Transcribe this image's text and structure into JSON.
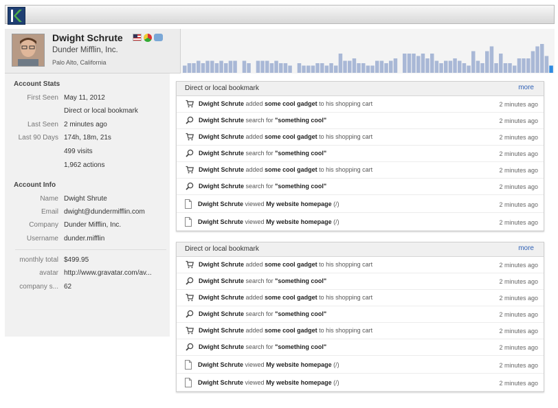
{
  "profile": {
    "name": "Dwight Schrute",
    "company": "Dunder Mifflin, Inc.",
    "location": "Palo Alto, California"
  },
  "activity_chart": {
    "type": "bar",
    "highlight_color": "#2f8be0",
    "bar_color": "#a9b8d6",
    "values": [
      3,
      4,
      4,
      5,
      4,
      5,
      5,
      4,
      5,
      4,
      5,
      5,
      0,
      5,
      4,
      0,
      5,
      5,
      5,
      4,
      5,
      4,
      4,
      3,
      0,
      4,
      3,
      3,
      3,
      4,
      4,
      3,
      4,
      3,
      8,
      5,
      5,
      6,
      4,
      4,
      3,
      3,
      5,
      5,
      4,
      5,
      6,
      0,
      8,
      8,
      8,
      7,
      8,
      6,
      8,
      5,
      4,
      5,
      5,
      6,
      5,
      4,
      3,
      9,
      5,
      4,
      9,
      11,
      4,
      8,
      4,
      4,
      3,
      6,
      6,
      6,
      9,
      11,
      12,
      7,
      3
    ],
    "highlight_last": true
  },
  "account_stats": {
    "title": "Account Stats",
    "rows": [
      {
        "key": "First Seen",
        "value": "May 11, 2012"
      },
      {
        "key": "",
        "value": "Direct or local bookmark"
      },
      {
        "key": "Last Seen",
        "value": "2 minutes ago"
      },
      {
        "key": "Last 90 Days",
        "value": "174h, 18m, 21s"
      },
      {
        "key": "",
        "value": "499 visits"
      },
      {
        "key": "",
        "value": "1,962 actions"
      }
    ]
  },
  "account_info": {
    "title": "Account Info",
    "rows": [
      {
        "key": "Name",
        "value": "Dwight Shrute"
      },
      {
        "key": "Email",
        "value": "dwight@dundermifflin.com"
      },
      {
        "key": "Company",
        "value": "Dunder Mifflin, Inc."
      },
      {
        "key": "Username",
        "value": "dunder.mifflin"
      }
    ],
    "extra": [
      {
        "key": "monthly total",
        "value": "$499.95"
      },
      {
        "key": "avatar",
        "value": "http://www.gravatar.com/av..."
      },
      {
        "key": "company s...",
        "value": "62"
      }
    ]
  },
  "panels": [
    {
      "title": "Direct or local bookmark",
      "more": "more",
      "items": [
        {
          "icon": "cart-icon",
          "user": "Dwight Schrute",
          "verb": "added",
          "object": "some cool gadget",
          "suffix": "to his shopping cart",
          "time": "2 minutes ago"
        },
        {
          "icon": "search-icon",
          "user": "Dwight Schrute",
          "verb": "search for",
          "object": "\"something cool\"",
          "suffix": "",
          "time": "2 minutes ago"
        },
        {
          "icon": "cart-icon",
          "user": "Dwight Schrute",
          "verb": "added",
          "object": "some cool gadget",
          "suffix": "to his shopping cart",
          "time": "2 minutes ago"
        },
        {
          "icon": "search-icon",
          "user": "Dwight Schrute",
          "verb": "search for",
          "object": "\"something cool\"",
          "suffix": "",
          "time": "2 minutes ago"
        },
        {
          "icon": "cart-icon",
          "user": "Dwight Schrute",
          "verb": "added",
          "object": "some cool gadget",
          "suffix": "to his shopping cart",
          "time": "2 minutes ago"
        },
        {
          "icon": "search-icon",
          "user": "Dwight Schrute",
          "verb": "search for",
          "object": "\"something cool\"",
          "suffix": "",
          "time": "2 minutes ago"
        },
        {
          "icon": "document-icon",
          "user": "Dwight Schrute",
          "verb": "viewed",
          "object": "My website homepage",
          "suffix": "(/)",
          "time": "2 minutes ago"
        },
        {
          "icon": "document-icon",
          "user": "Dwight Schrute",
          "verb": "viewed",
          "object": "My website homepage",
          "suffix": "(/)",
          "time": "2 minutes ago"
        }
      ]
    },
    {
      "title": "Direct or local bookmark",
      "more": "more",
      "items": [
        {
          "icon": "cart-icon",
          "user": "Dwight Schrute",
          "verb": "added",
          "object": "some cool gadget",
          "suffix": "to his shopping cart",
          "time": "2 minutes ago"
        },
        {
          "icon": "search-icon",
          "user": "Dwight Schrute",
          "verb": "search for",
          "object": "\"something cool\"",
          "suffix": "",
          "time": "2 minutes ago"
        },
        {
          "icon": "cart-icon",
          "user": "Dwight Schrute",
          "verb": "added",
          "object": "some cool gadget",
          "suffix": "to his shopping cart",
          "time": "2 minutes ago"
        },
        {
          "icon": "search-icon",
          "user": "Dwight Schrute",
          "verb": "search for",
          "object": "\"something cool\"",
          "suffix": "",
          "time": "2 minutes ago"
        },
        {
          "icon": "cart-icon",
          "user": "Dwight Schrute",
          "verb": "added",
          "object": "some cool gadget",
          "suffix": "to his shopping cart",
          "time": "2 minutes ago"
        },
        {
          "icon": "search-icon",
          "user": "Dwight Schrute",
          "verb": "search for",
          "object": "\"something cool\"",
          "suffix": "",
          "time": "2 minutes ago"
        },
        {
          "icon": "document-icon",
          "user": "Dwight Schrute",
          "verb": "viewed",
          "object": "My website homepage",
          "suffix": "(/)",
          "time": "2 minutes ago"
        },
        {
          "icon": "document-icon",
          "user": "Dwight Schrute",
          "verb": "viewed",
          "object": "My website homepage",
          "suffix": "(/)",
          "time": "2 minutes ago"
        }
      ]
    }
  ]
}
